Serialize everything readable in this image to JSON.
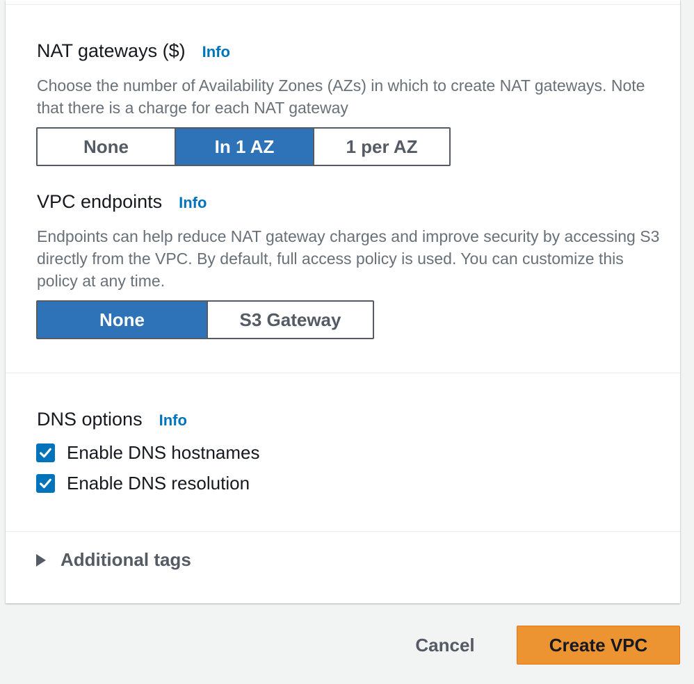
{
  "nat_gateways": {
    "label": "NAT gateways ($)",
    "info": "Info",
    "description": "Choose the number of Availability Zones (AZs) in which to create NAT gateways. Note that there is a charge for each NAT gateway",
    "options": [
      "None",
      "In 1 AZ",
      "1 per AZ"
    ],
    "selected": "In 1 AZ"
  },
  "vpc_endpoints": {
    "label": "VPC endpoints",
    "info": "Info",
    "description": "Endpoints can help reduce NAT gateway charges and improve security by accessing S3 directly from the VPC. By default, full access policy is used. You can customize this policy at any time.",
    "options": [
      "None",
      "S3 Gateway"
    ],
    "selected": "None"
  },
  "dns_options": {
    "label": "DNS options",
    "info": "Info",
    "checkboxes": [
      {
        "label": "Enable DNS hostnames",
        "checked": true
      },
      {
        "label": "Enable DNS resolution",
        "checked": true
      }
    ]
  },
  "additional_tags": {
    "label": "Additional tags",
    "expanded": false,
    "icon": "caret-right-icon"
  },
  "footer": {
    "cancel_label": "Cancel",
    "create_label": "Create VPC"
  },
  "colors": {
    "accent": "#2e73b8",
    "link": "#0073bb",
    "primary_button": "#ec9332",
    "background": "#f2f3f3"
  }
}
